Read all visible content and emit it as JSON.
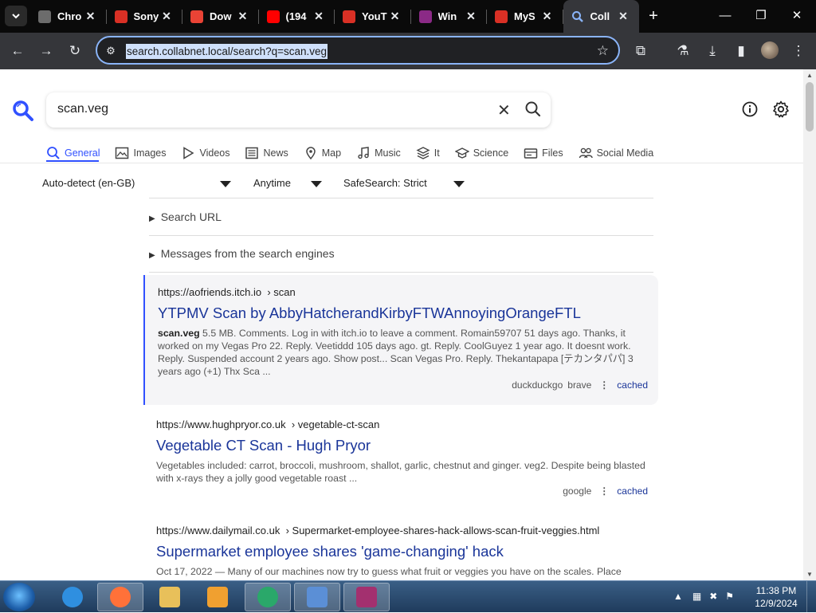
{
  "browser": {
    "tabs": [
      {
        "title": "Chro",
        "icon": "chrome-web-store-icon",
        "color": "#6c6c6c",
        "active": false
      },
      {
        "title": "Sony",
        "icon": "download-red-icon",
        "color": "#d93025",
        "active": false
      },
      {
        "title": "Dow",
        "icon": "gmail-icon",
        "color": "#ea4335",
        "active": false
      },
      {
        "title": "(194",
        "icon": "youtube-icon",
        "color": "#ff0000",
        "active": false
      },
      {
        "title": "YouT",
        "icon": "download-red-icon",
        "color": "#d93025",
        "active": false
      },
      {
        "title": "Win",
        "icon": "winrar-icon",
        "color": "#8b2a86",
        "active": false
      },
      {
        "title": "MyS",
        "icon": "download-red-icon",
        "color": "#d93025",
        "active": false
      },
      {
        "title": "Coll",
        "icon": "search-icon",
        "color": "#3050ff",
        "active": true
      }
    ],
    "url": "search.collabnet.local/search?q=scan.veg"
  },
  "search": {
    "query": "scan.veg",
    "categories": [
      {
        "label": "General",
        "icon": "search-icon",
        "active": true
      },
      {
        "label": "Images",
        "icon": "image-icon",
        "active": false
      },
      {
        "label": "Videos",
        "icon": "play-icon",
        "active": false
      },
      {
        "label": "News",
        "icon": "newspaper-icon",
        "active": false
      },
      {
        "label": "Map",
        "icon": "map-pin-icon",
        "active": false
      },
      {
        "label": "Music",
        "icon": "music-note-icon",
        "active": false
      },
      {
        "label": "It",
        "icon": "layers-icon",
        "active": false
      },
      {
        "label": "Science",
        "icon": "graduation-cap-icon",
        "active": false
      },
      {
        "label": "Files",
        "icon": "drive-icon",
        "active": false
      },
      {
        "label": "Social Media",
        "icon": "people-icon",
        "active": false
      }
    ],
    "filters": {
      "language": "Auto-detect (en-GB)",
      "time": "Anytime",
      "safesearch": "SafeSearch: Strict"
    },
    "details": {
      "search_url": "Search URL",
      "engine_messages": "Messages from the search engines"
    },
    "results": [
      {
        "url_host": "https://aofriends.itch.io",
        "url_path": "› scan",
        "title": "YTPMV Scan by AbbyHatcherandKirbyFTWAnnoyingOrangeFTL",
        "snippet_bold": "scan.veg",
        "snippet": " 5.5 MB. Comments. Log in with itch.io to leave a comment. Romain59707 51 days ago. Thanks, it worked on my Vegas Pro 22. Reply. Veetiddd 105 days ago. gt. Reply. CoolGuyez 1 year ago. It doesnt work. Reply. Suspended account 2 years ago. Show post... Scan Vegas Pro. Reply. Thekantapapa [テカンタパパ] 3 years ago (+1) Thx Sca ...",
        "engines": [
          "duckduckgo",
          "brave"
        ],
        "cached": "cached"
      },
      {
        "url_host": "https://www.hughpryor.co.uk",
        "url_path": "› vegetable-ct-scan",
        "title": "Vegetable CT Scan - Hugh Pryor",
        "snippet_bold": "",
        "snippet": "Vegetables included: carrot, broccoli, mushroom, shallot, garlic, chestnut and ginger. veg2. Despite being blasted with x-rays they a jolly good vegetable roast ...",
        "engines": [
          "google"
        ],
        "cached": "cached"
      },
      {
        "url_host": "https://www.dailymail.co.uk",
        "url_path": "› Supermarket-employee-shares-hack-allows-scan-fruit-veggies.html",
        "title": "Supermarket employee shares 'game-changing' hack",
        "snippet_bold": "",
        "snippet": "Oct 17, 2022 — Many of our machines now try to guess what fruit or veggies you have on the scales. Place",
        "engines": [],
        "cached": ""
      }
    ]
  },
  "taskbar": {
    "apps": [
      {
        "icon": "internet-explorer-icon",
        "color": "#2f8fe0",
        "selected": false
      },
      {
        "icon": "firefox-icon",
        "color": "#ff7139",
        "selected": true
      },
      {
        "icon": "file-explorer-icon",
        "color": "#e8c05a",
        "selected": false
      },
      {
        "icon": "media-player-icon",
        "color": "#f0a030",
        "selected": false
      },
      {
        "icon": "chrome-app-icon",
        "color": "#2aa86a",
        "selected": true
      },
      {
        "icon": "control-panel-icon",
        "color": "#5b8fd6",
        "selected": true
      },
      {
        "icon": "winrar-icon",
        "color": "#a3306f",
        "selected": true
      }
    ],
    "time": "11:38 PM",
    "date": "12/9/2024"
  },
  "colors": {
    "accent": "#3050ff",
    "link": "#1a3599"
  }
}
